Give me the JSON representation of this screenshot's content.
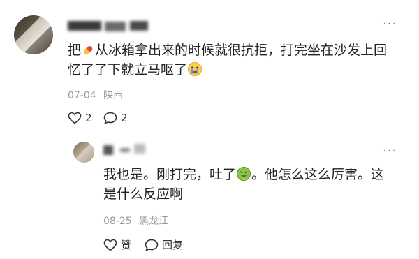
{
  "comment": {
    "username": "",
    "text_line1_a": "把",
    "text_line1_b": "从冰箱拿出来的时候就很抗拒，打完坐在沙发上回",
    "text_line2": "忆了了下就立马呕了",
    "emoji_pill": "pill-emoji",
    "emoji_cry": "crying-face-emoji",
    "date": "07-04",
    "location": "陕西",
    "like_count": "2",
    "reply_count": "2",
    "more_icon": "more-dots-icon"
  },
  "reply": {
    "username": "",
    "text_line1_a": "我也是。刚打完，吐了",
    "text_line1_b": "。他怎么这么厉害。这",
    "text_line2": "是什么反应啊",
    "emoji_vomit": "vomiting-face-emoji",
    "date": "08-25",
    "location": "黑龙江",
    "like_label": "赞",
    "reply_label": "回复",
    "more_icon": "more-dots-icon"
  },
  "colors": {
    "text": "#222222",
    "meta": "#9a9a9a",
    "background": "#ffffff"
  }
}
